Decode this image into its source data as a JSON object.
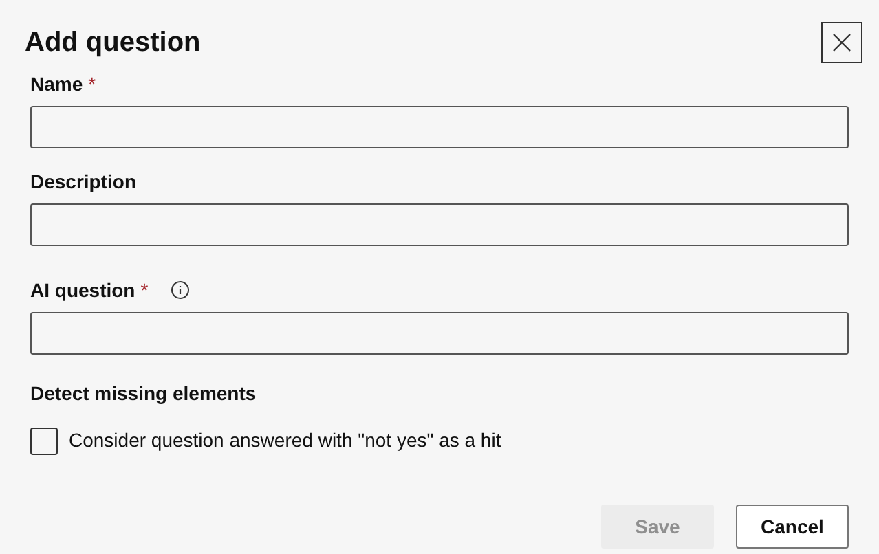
{
  "dialog": {
    "title": "Add question"
  },
  "fields": [
    {
      "label": "Name",
      "required_mark": "*",
      "info": false
    },
    {
      "label": "Description",
      "info": false
    },
    {
      "label": "AI question",
      "required_mark": "*",
      "info": true
    }
  ],
  "section": {
    "title": "Detect missing elements"
  },
  "checkbox": {
    "label": "Consider question answered with \"not yes\" as a hit",
    "checked": false
  },
  "buttons": [
    {
      "label": "Save",
      "kind": "primary",
      "disabled": true
    },
    {
      "label": "Cancel",
      "kind": "secondary",
      "disabled": false
    }
  ]
}
